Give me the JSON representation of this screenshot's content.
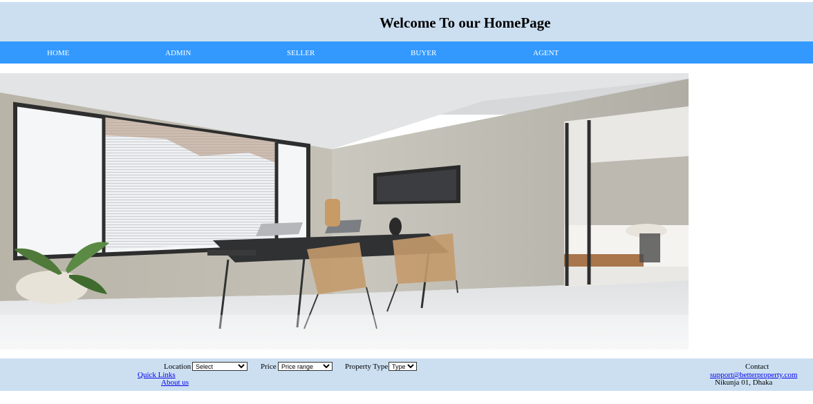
{
  "header": {
    "title": "Welcome To our HomePage",
    "bg_color": "#cbdff1"
  },
  "nav": {
    "bg_color": "#3399ff",
    "items": [
      {
        "label": "HOME"
      },
      {
        "label": "ADMIN"
      },
      {
        "label": "SELLER"
      },
      {
        "label": "BUYER"
      },
      {
        "label": "AGENT"
      }
    ]
  },
  "hero": {
    "subject": "interior-room-photo"
  },
  "filters": {
    "location": {
      "label": "Location",
      "selected": "Select"
    },
    "price": {
      "label": "Price",
      "selected": "Price range"
    },
    "property_type": {
      "label": "Property Type",
      "selected": "Type"
    }
  },
  "footer": {
    "quick_links": "Quick Links",
    "about_us": "About us",
    "contact_label": "Contact",
    "email": "support@betterproperty.com",
    "address": "Nikunja 01, Dhaka"
  }
}
